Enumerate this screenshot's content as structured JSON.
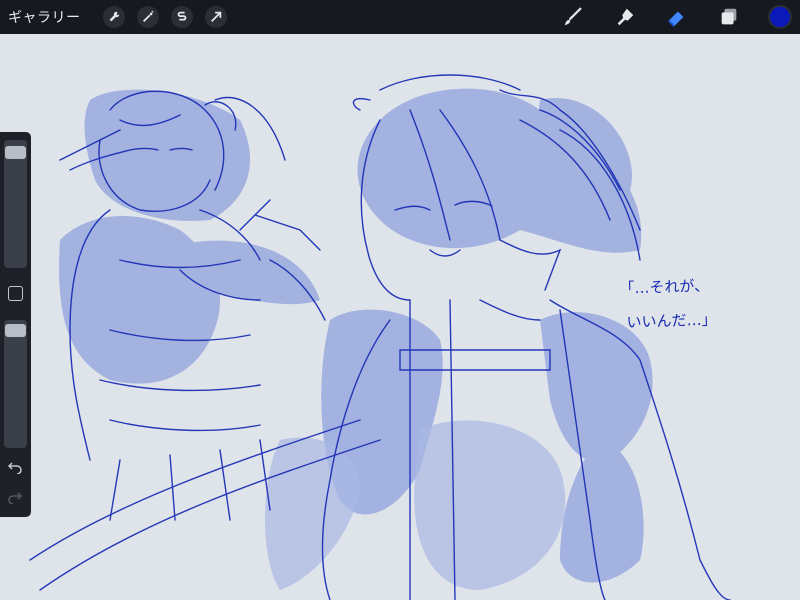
{
  "topbar": {
    "gallery_label": "ギャラリー",
    "left_tools": [
      "wrench-icon",
      "magic-wand-icon",
      "selection-icon",
      "transform-arrow-icon"
    ],
    "right_tools": [
      "brush-icon",
      "smudge-icon",
      "eraser-icon",
      "layers-icon"
    ],
    "active_tool": "eraser-icon",
    "current_color": "#0b19b8"
  },
  "sidebar": {
    "brush_size_level": 0.96,
    "opacity_level": 0.97
  },
  "drawing_note": {
    "line1": "「…それが、",
    "line2": "いいんだ…」"
  }
}
